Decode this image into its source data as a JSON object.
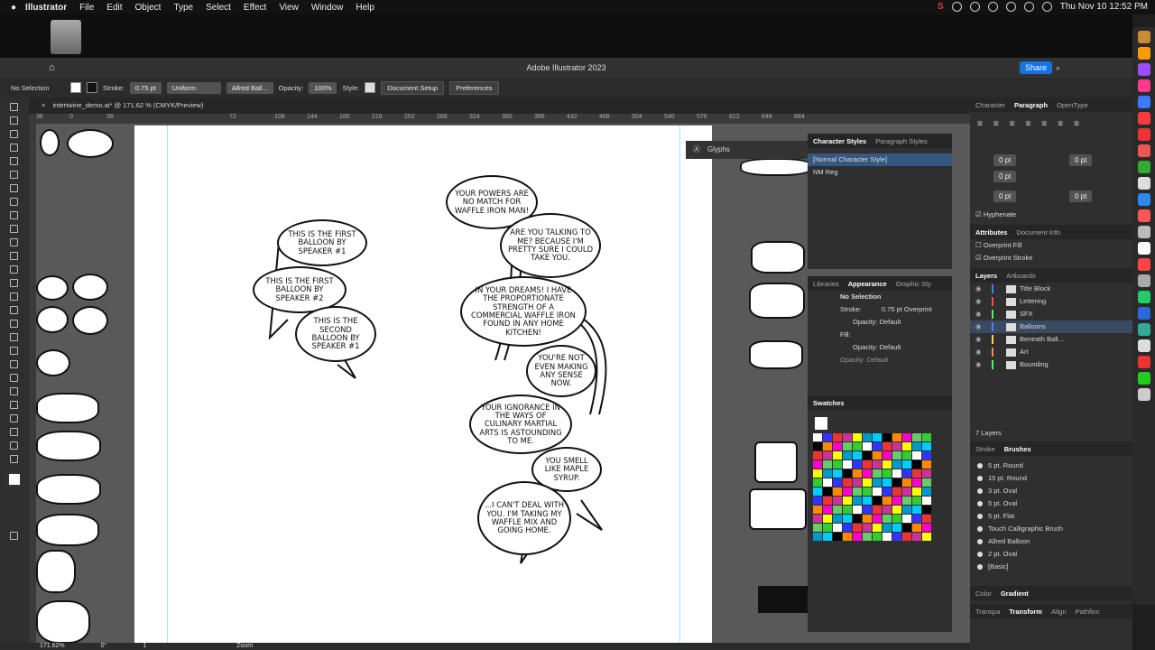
{
  "menubar": {
    "apple": "",
    "app": "Illustrator",
    "items": [
      "File",
      "Edit",
      "Object",
      "Type",
      "Select",
      "Effect",
      "View",
      "Window",
      "Help"
    ],
    "clock": "Thu Nov 10  12:52 PM"
  },
  "window": {
    "title": "Adobe Illustrator 2023",
    "share": "Share"
  },
  "control": {
    "selection": "No Selection",
    "stroke_label": "Stroke:",
    "stroke_value": "0.75 pt",
    "profile": "Uniform",
    "brush": "Allred Ball...",
    "opacity_label": "Opacity:",
    "opacity_value": "100%",
    "style_label": "Style:",
    "doc_setup": "Document Setup",
    "preferences": "Preferences"
  },
  "doc_tab": {
    "name": "intertwine_demo.ai* @ 171.62 % (CMYK/Preview)"
  },
  "ruler": {
    "ticks": [
      "36",
      "0",
      "36",
      "72",
      "108",
      "144",
      "180",
      "216",
      "252",
      "288",
      "324",
      "360",
      "396",
      "432",
      "468",
      "504",
      "540",
      "576",
      "612",
      "648",
      "684"
    ]
  },
  "balloons": [
    {
      "name": "balloon-first-speaker1",
      "text": "THIS IS THE FIRST BALLOON BY SPEAKER #1"
    },
    {
      "name": "balloon-first-speaker2",
      "text": "THIS IS THE FIRST BALLOON BY SPEAKER #2"
    },
    {
      "name": "balloon-second-speaker1",
      "text": "THIS IS THE SECOND BALLOON BY SPEAKER #1"
    },
    {
      "name": "balloon-powers",
      "text": "YOUR POWERS ARE NO MATCH FOR WAFFLE IRON MAN!"
    },
    {
      "name": "balloon-talking",
      "text": "ARE YOU TALKING TO ME? BECAUSE I'M PRETTY SURE I COULD TAKE YOU."
    },
    {
      "name": "balloon-dreams",
      "text": "IN YOUR DREAMS! I HAVE THE PROPORTIONATE STRENGTH OF A COMMERCIAL WAFFLE IRON FOUND IN ANY HOME KITCHEN!"
    },
    {
      "name": "balloon-sense",
      "text": "YOU'RE NOT EVEN MAKING ANY SENSE NOW."
    },
    {
      "name": "balloon-ignorance",
      "text": "YOUR IGNORANCE IN THE WAYS OF CULINARY MARTIAL ARTS IS ASTOUNDING TO ME."
    },
    {
      "name": "balloon-syrup",
      "text": "YOU SMELL LIKE MAPLE SYRUP."
    },
    {
      "name": "balloon-cant-deal",
      "text": "...I CAN'T DEAL WITH YOU. I'M TAKING MY WAFFLE MIX AND GOING HOME."
    }
  ],
  "glyphs": {
    "title": "Glyphs"
  },
  "char_styles": {
    "tabs": [
      "Character Styles",
      "Paragraph Styles"
    ],
    "items": [
      "[Normal Character Style]",
      "NM Reg"
    ]
  },
  "appearance": {
    "tabs": [
      "Libraries",
      "Appearance",
      "Graphic Sty"
    ],
    "no_selection": "No Selection",
    "stroke": "Stroke:",
    "stroke_val": "0.75 pt Overprint",
    "opacity1": "Opacity: Default",
    "fill": "Fill:",
    "opacity2": "Opacity: Default",
    "opacity3": "Opacity: Default"
  },
  "swatches": {
    "title": "Swatches"
  },
  "character_panel": {
    "tabs": [
      "Character",
      "Paragraph",
      "OpenType"
    ],
    "fields": [
      "0 pt",
      "0 pt",
      "0 pt",
      "0 pt",
      "0 pt"
    ],
    "hyphenate": "Hyphenate"
  },
  "attributes": {
    "tabs": [
      "Attributes",
      "Document Info"
    ],
    "overprint_fill": "Overprint Fill",
    "overprint_stroke": "Overprint Stroke"
  },
  "layers": {
    "tabs": [
      "Layers",
      "Artboards"
    ],
    "items": [
      "Title Block",
      "Lettering",
      "SFX",
      "Balloons",
      "Beneath Ball...",
      "Art",
      "Bounding"
    ],
    "count": "7 Layers"
  },
  "brushes": {
    "tabs": [
      "Stroke",
      "Brushes"
    ],
    "items": [
      "5 pt. Round",
      "15 pt. Round",
      "3 pt. Oval",
      "5 pt. Oval",
      "5 pt. Flat",
      "Touch Calligraphic Brush",
      "Allred Balloon",
      "2 pt. Oval",
      "[Basic]"
    ]
  },
  "bottom_tabs": {
    "color": [
      "Color",
      "Gradient"
    ],
    "transform": [
      "Transpa",
      "Transform",
      "Align",
      "Pathfinc"
    ]
  },
  "status": {
    "zoom": "171.62%",
    "angle": "0°",
    "artboard": "1",
    "mode": "Zoom"
  },
  "colors": {
    "layer_colors": [
      "#4a7bff",
      "#ff4a4a",
      "#4aff4a",
      "#4a7bff",
      "#ffd24a",
      "#ff8a4a",
      "#4aff4a"
    ],
    "accent": "#1473e6"
  }
}
